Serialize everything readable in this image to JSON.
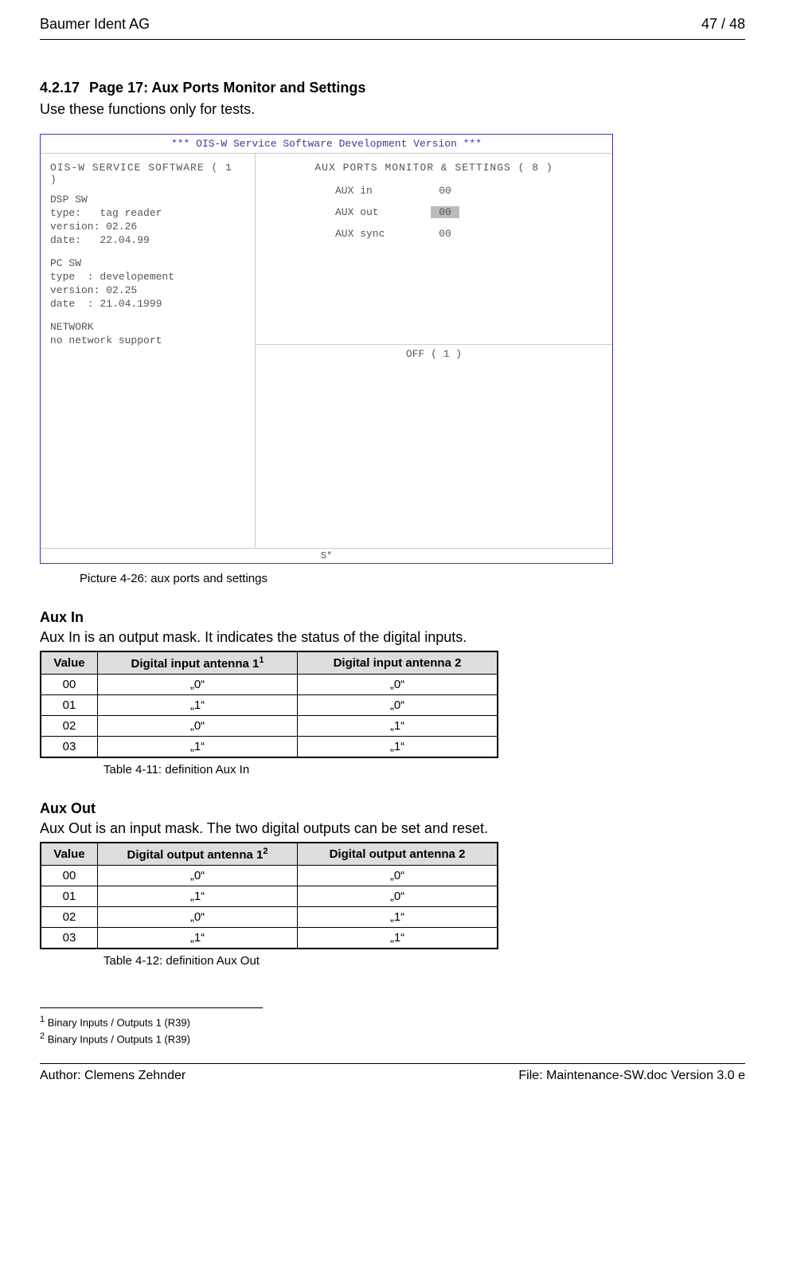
{
  "header": {
    "company": "Baumer Ident AG",
    "page_num": "47 / 48"
  },
  "section": {
    "number": "4.2.17",
    "title": "Page 17: Aux Ports Monitor and Settings",
    "intro": "Use these functions only for tests."
  },
  "software": {
    "window_title": "*** OIS-W Service Software Development Version ***",
    "left": {
      "title": "OIS-W SERVICE SOFTWARE ( 1 )",
      "dsp_heading": "DSP SW",
      "dsp_type": "type:   tag reader",
      "dsp_version": "version: 02.26",
      "dsp_date": "date:   22.04.99",
      "pc_heading": "PC SW",
      "pc_type": "type  : developement",
      "pc_version": "version: 02.25",
      "pc_date": "date  : 21.04.1999",
      "net_heading": "NETWORK",
      "net_text": "no network support"
    },
    "right": {
      "title": "AUX PORTS MONITOR & SETTINGS ( 8 )",
      "rows": {
        "in": {
          "label": "AUX in",
          "value": "00"
        },
        "out": {
          "label": "AUX out",
          "value": "00"
        },
        "sync": {
          "label": "AUX sync",
          "value": "00"
        }
      },
      "bottom_label": "OFF ( 1 )"
    },
    "status": "S*"
  },
  "picture_caption": "Picture 4-26: aux ports and settings",
  "aux_in": {
    "heading": "Aux In",
    "text": "Aux In is an output mask. It indicates the status of the digital inputs.",
    "cols": {
      "c1": "Value",
      "c2_pre": "Digital input antenna 1",
      "c2_sup": "1",
      "c3": "Digital input antenna 2"
    },
    "rows": {
      "r0": {
        "v": "00",
        "a1": "„0“",
        "a2": "„0“"
      },
      "r1": {
        "v": "01",
        "a1": "„1“",
        "a2": "„0“"
      },
      "r2": {
        "v": "02",
        "a1": "„0“",
        "a2": "„1“"
      },
      "r3": {
        "v": "03",
        "a1": "„1“",
        "a2": "„1“"
      }
    },
    "caption": "Table 4-11: definition Aux In"
  },
  "aux_out": {
    "heading": "Aux Out",
    "text": "Aux Out is an input mask. The two digital outputs can be set and reset.",
    "cols": {
      "c1": "Value",
      "c2_pre": "Digital  output antenna 1",
      "c2_sup": "2",
      "c3": "Digital output antenna 2"
    },
    "rows": {
      "r0": {
        "v": "00",
        "a1": "„0“",
        "a2": "„0“"
      },
      "r1": {
        "v": "01",
        "a1": "„1“",
        "a2": "„0“"
      },
      "r2": {
        "v": "02",
        "a1": "„0“",
        "a2": "„1“"
      },
      "r3": {
        "v": "03",
        "a1": "„1“",
        "a2": "„1“"
      }
    },
    "caption": "Table 4-12: definition Aux Out"
  },
  "footnotes": {
    "f1": {
      "num": "1",
      "text": " Binary Inputs / Outputs 1 (R39)"
    },
    "f2": {
      "num": "2",
      "text": " Binary Inputs / Outputs 1 (R39)"
    }
  },
  "footer": {
    "author": "Author: Clemens Zehnder",
    "file": "File: Maintenance-SW.doc Version 3.0 e"
  }
}
